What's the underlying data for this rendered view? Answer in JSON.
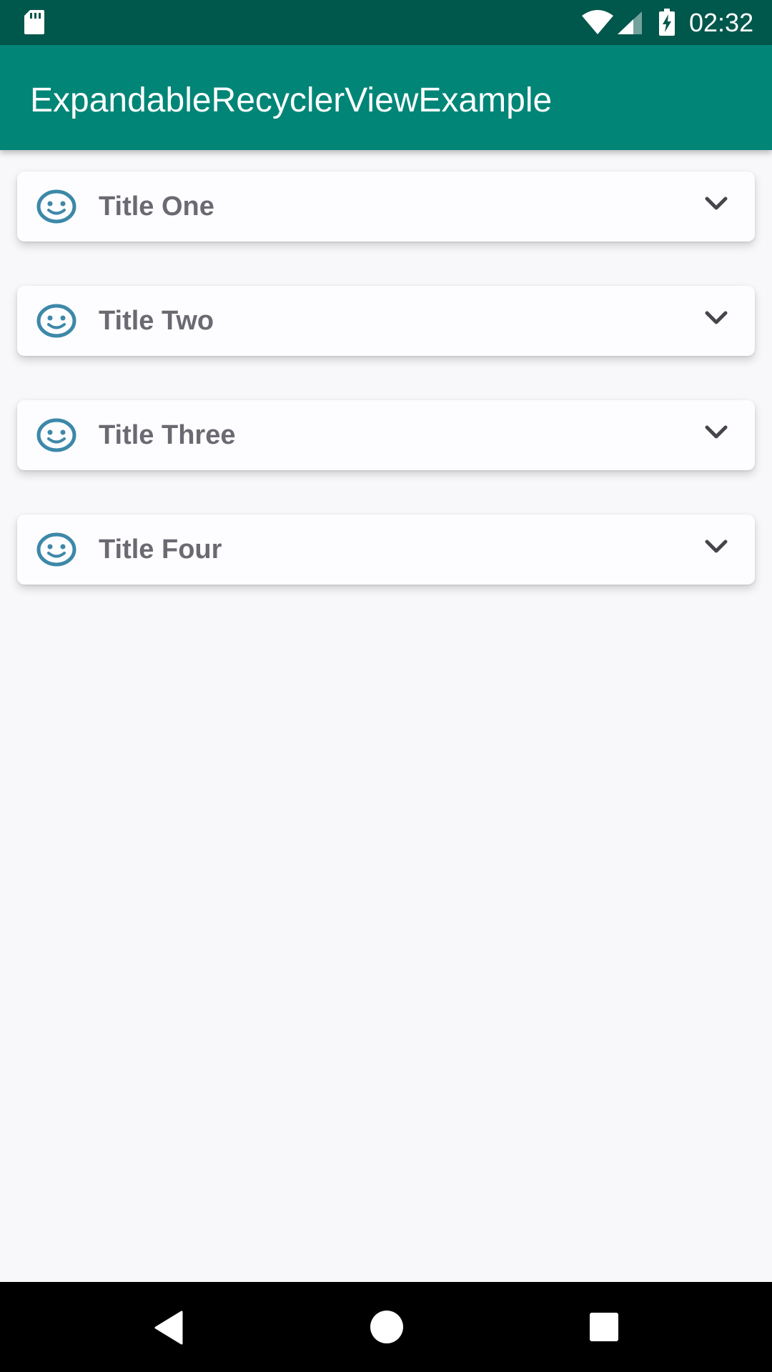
{
  "status_bar": {
    "time": "02:32",
    "icons": [
      "sd-card-icon",
      "wifi-icon",
      "signal-icon",
      "battery-charging-icon"
    ]
  },
  "app_bar": {
    "title": "ExpandableRecyclerViewExample"
  },
  "list": {
    "items": [
      {
        "title": "Title One",
        "icon": "smile-face-icon",
        "expand_icon": "chevron-down-icon"
      },
      {
        "title": "Title Two",
        "icon": "smile-face-icon",
        "expand_icon": "chevron-down-icon"
      },
      {
        "title": "Title Three",
        "icon": "smile-face-icon",
        "expand_icon": "chevron-down-icon"
      },
      {
        "title": "Title Four",
        "icon": "smile-face-icon",
        "expand_icon": "chevron-down-icon"
      }
    ]
  },
  "nav_bar": {
    "icons": [
      "back-icon",
      "home-icon",
      "recents-icon"
    ]
  },
  "colors": {
    "status_bar": "#00574b",
    "app_bar": "#008577",
    "icon_accent": "#3d88a8",
    "title_text": "#6b6a72"
  }
}
